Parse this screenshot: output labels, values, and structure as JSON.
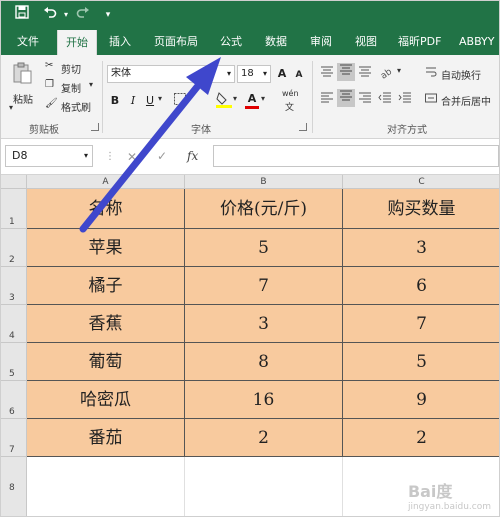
{
  "quick_access": {
    "save_icon": "save-icon",
    "undo_icon": "undo-icon",
    "redo_icon": "redo-icon",
    "customize_icon": "customize-icon"
  },
  "tabs": [
    "文件",
    "开始",
    "插入",
    "页面布局",
    "公式",
    "数据",
    "审阅",
    "视图",
    "福昕PDF",
    "ABBYY"
  ],
  "active_tab": "开始",
  "ribbon": {
    "clipboard": {
      "paste": "粘贴",
      "cut": "剪切",
      "copy": "复制",
      "format_painter": "格式刷",
      "group": "剪贴板"
    },
    "font": {
      "name": "宋体",
      "size": "18",
      "grow": "A",
      "shrink": "A",
      "bold": "B",
      "italic": "I",
      "underline": "U",
      "color_a": "A",
      "phonetic": "wén",
      "group": "字体"
    },
    "alignment": {
      "wrap": "自动换行",
      "merge": "合并后居中",
      "group": "对齐方式"
    }
  },
  "formula_bar": {
    "name_box": "D8",
    "fx": "fx",
    "value": ""
  },
  "columns": [
    "A",
    "B",
    "C"
  ],
  "rows": [
    "1",
    "2",
    "3",
    "4",
    "5",
    "6",
    "7",
    "8"
  ],
  "table": {
    "headers": [
      "名称",
      "价格(元/斤)",
      "购买数量"
    ],
    "data": [
      [
        "苹果",
        "5",
        "3"
      ],
      [
        "橘子",
        "7",
        "6"
      ],
      [
        "香蕉",
        "3",
        "7"
      ],
      [
        "葡萄",
        "8",
        "5"
      ],
      [
        "哈密瓜",
        "16",
        "9"
      ],
      [
        "番茄",
        "2",
        "2"
      ]
    ]
  },
  "colors": {
    "excel_green": "#217346",
    "cell_fill": "#f8ca9e",
    "arrow": "#3f47cc"
  },
  "watermark": {
    "brand": "Bai度",
    "sub": "jingyan.baidu.com"
  }
}
